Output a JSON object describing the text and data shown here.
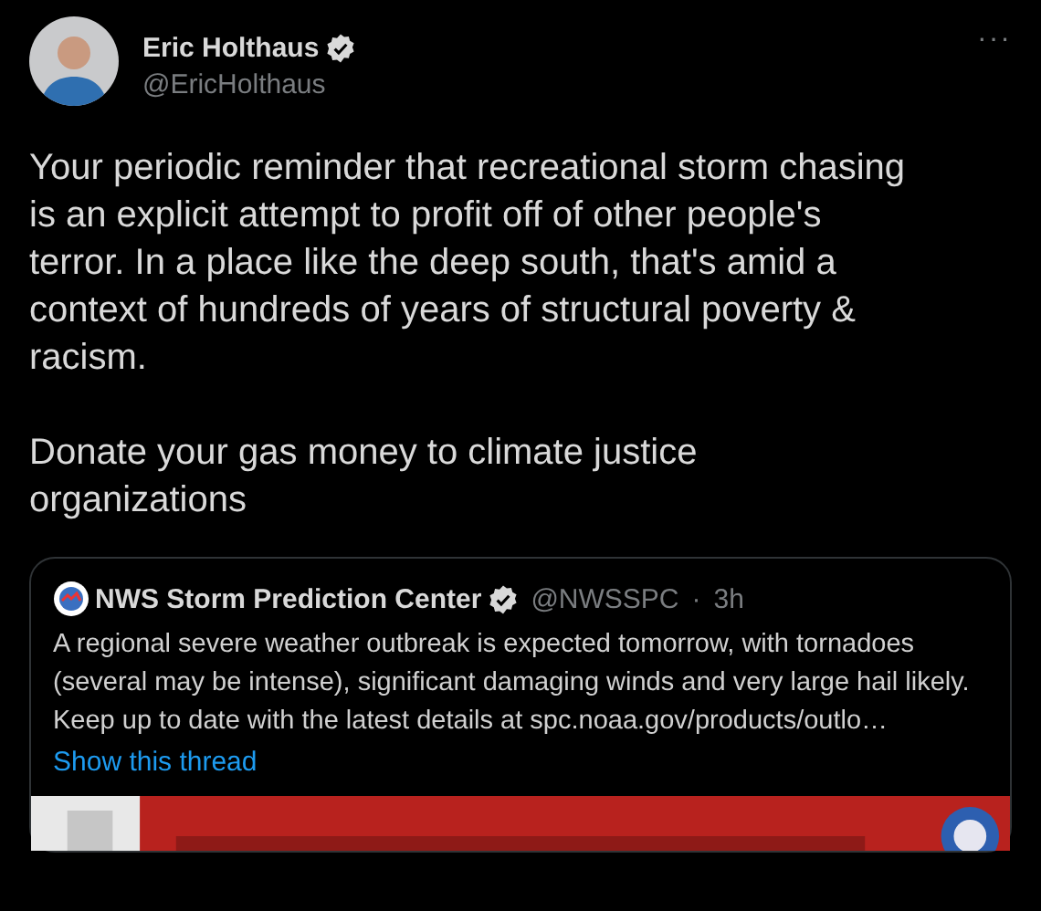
{
  "author": {
    "name": "Eric Holthaus",
    "verified": true,
    "handle": "@EricHolthaus"
  },
  "menu": "···",
  "paragraphs": [
    "Your periodic reminder that recreational storm chasing is an explicit attempt to profit off of other people's terror. In a place like the deep south, that's amid a context of hundreds of years of structural poverty & racism.",
    "Donate your gas money to climate justice organizations"
  ],
  "quoted": {
    "name": "NWS Storm Prediction Center",
    "verified": true,
    "handle": "@NWSSPC",
    "separator": "·",
    "time": "3h",
    "text": "A regional severe weather outbreak is expected tomorrow, with tornadoes (several may be intense), significant damaging winds and very large hail likely. Keep up to date with the latest details at spc.noaa.gov/products/outlo…",
    "thread_link": "Show this thread"
  }
}
